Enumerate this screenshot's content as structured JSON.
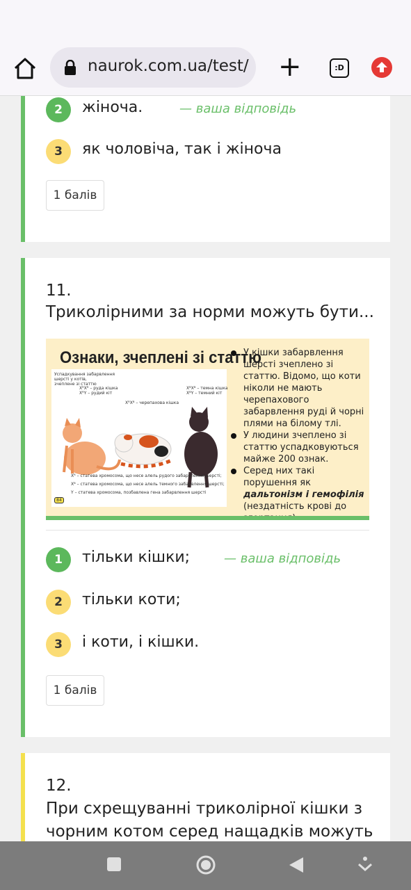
{
  "browser": {
    "url": "naurok.com.ua/test/c",
    "tabs_label": ":D"
  },
  "q10": {
    "options": [
      {
        "num": "2",
        "text": "жіноча.",
        "answer_tag": "— ваша відповідь"
      },
      {
        "num": "3",
        "text": "як чоловіча, так і жіноча"
      }
    ],
    "score": "1 балів"
  },
  "q11": {
    "number": "11.",
    "question": "Триколірними за норми можуть бути...",
    "image": {
      "title": "Ознаки, зчеплені зі статтю",
      "panel_caption": [
        "Успадкування забарвлення",
        "шерсті у котів,",
        "зчеплене зі статтю"
      ],
      "genotypes": [
        "XᴿXᴿ – руда кішка",
        "XᴿY – рудий кіт",
        "XᴿXᴮ – черепахова кішка",
        "XᴮXᴮ – темна кішка",
        "XᴮY – темний кіт"
      ],
      "legend": [
        "Xᴿ – статева хромосома, що несе алель рудого забарвлення шерсті;",
        "Xᴮ – статева хромосома, що несе алель темного забарвлення шерсті;",
        "Y – статева хромосома, позбавлена гена забарвлення шерсті"
      ],
      "page_badge": "84",
      "bullets": [
        "У кішки забарвлення шерсті зчеплено зі статтю. Відомо, що коти ніколи не мають черепахового забарвлення руді й чорні плями на білому тлі.",
        "У людини зчеплено зі статтю успадковуються майже 200 ознак."
      ],
      "bullet3_before": "Серед них такі порушення як ",
      "bullet3_bold": "дальтонізм і гемофілія",
      "bullet3_after": " (нездатність крові до згортання)."
    },
    "options": [
      {
        "num": "1",
        "text": "тільки кішки;",
        "answer_tag": "— ваша відповідь"
      },
      {
        "num": "2",
        "text": "тільки коти;"
      },
      {
        "num": "3",
        "text": "і коти, і кішки."
      }
    ],
    "score": "1 балів"
  },
  "q12": {
    "number": "12.",
    "question": "При схрещуванні триколірної кішки з чорним котом серед нащадків можуть"
  },
  "colors": {
    "accent_green": "#6abf69",
    "badge_green": "#5cb85c",
    "badge_yellow": "#fbdc75",
    "pending_yellow": "#f4e04d",
    "update_red": "#e53935"
  }
}
